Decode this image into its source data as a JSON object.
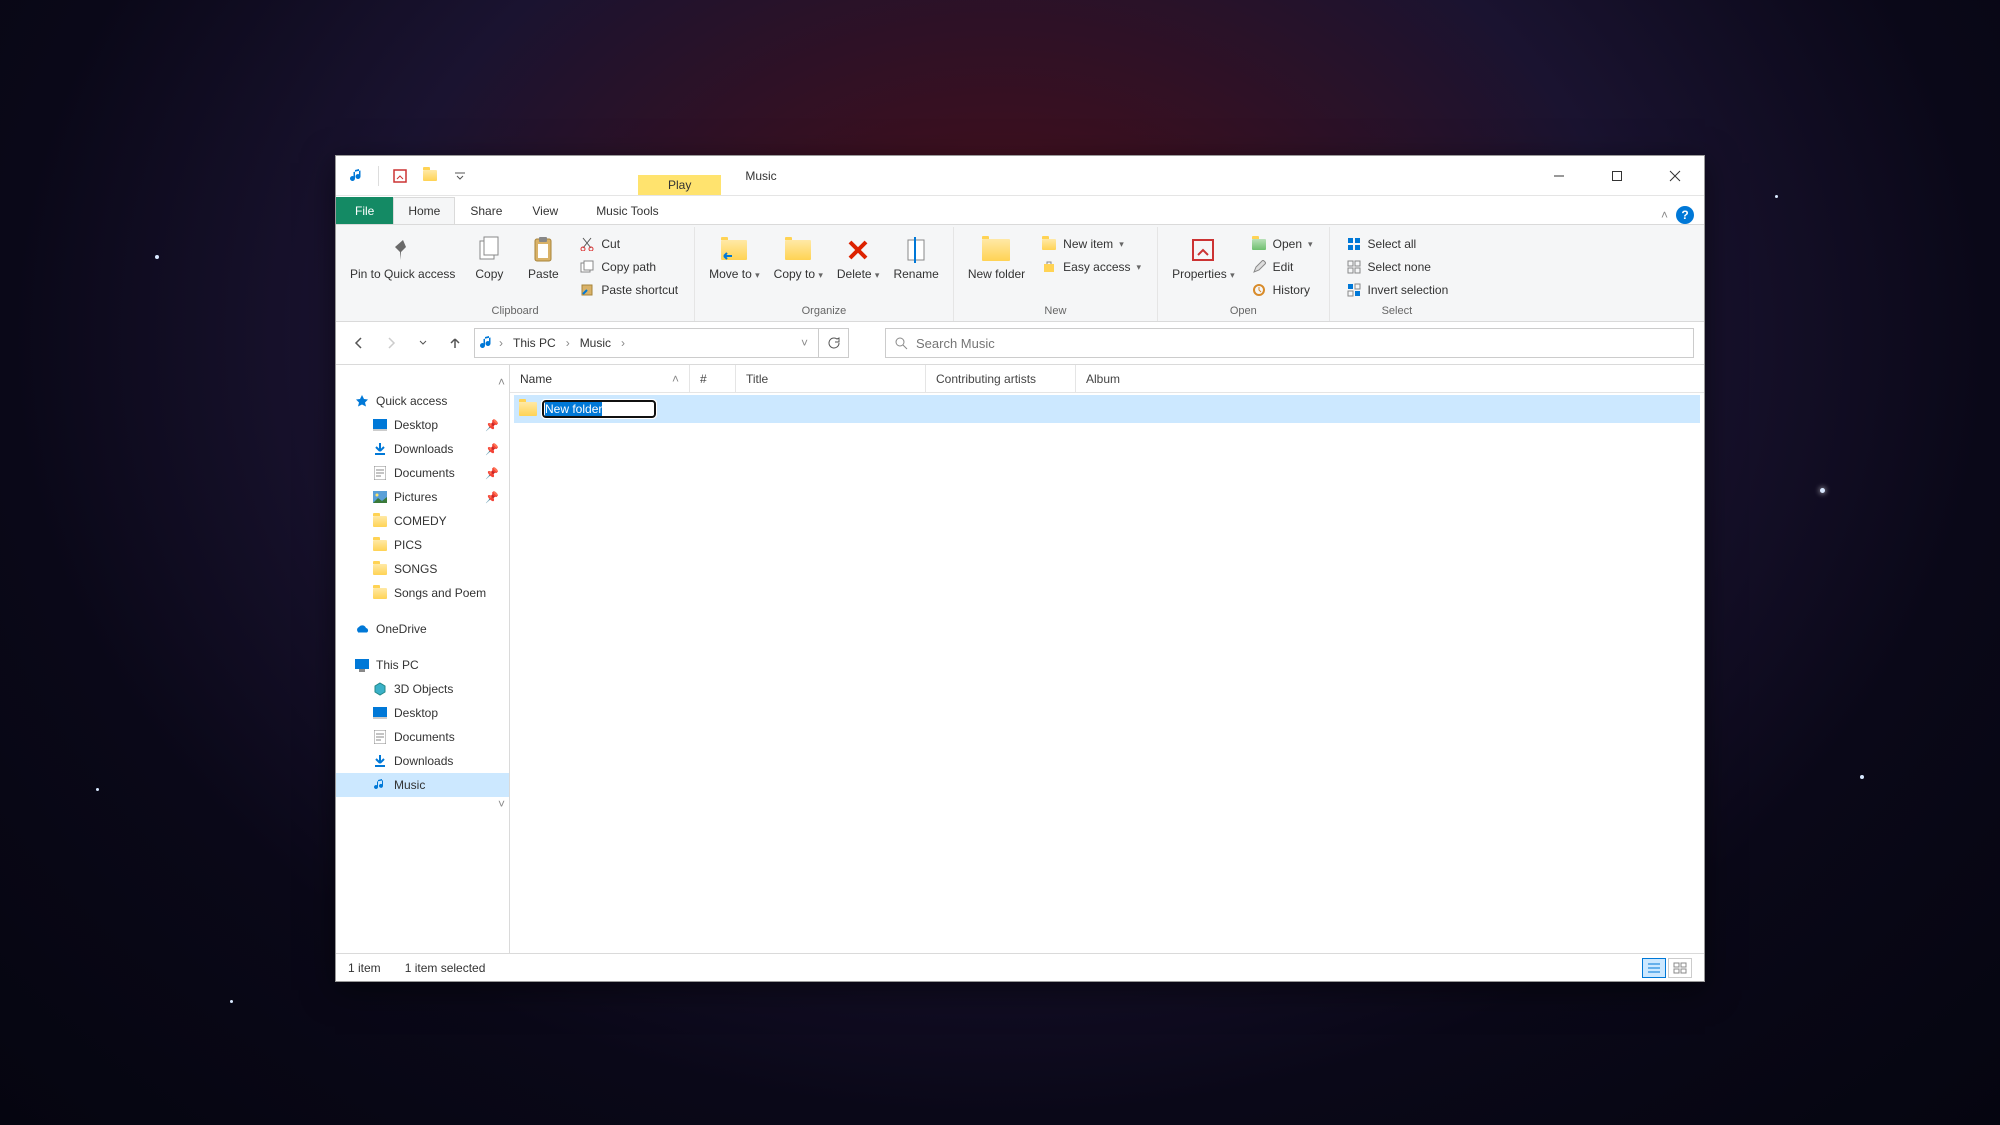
{
  "title": "Music",
  "contextTab": {
    "header": "Play",
    "label": "Music Tools"
  },
  "tabs": {
    "file": "File",
    "home": "Home",
    "share": "Share",
    "view": "View"
  },
  "ribbon": {
    "clipboard": {
      "label": "Clipboard",
      "pin": "Pin to Quick access",
      "copy": "Copy",
      "paste": "Paste",
      "cut": "Cut",
      "copyPath": "Copy path",
      "pasteShortcut": "Paste shortcut"
    },
    "organize": {
      "label": "Organize",
      "moveTo": "Move to",
      "copyTo": "Copy to",
      "delete": "Delete",
      "rename": "Rename"
    },
    "new": {
      "label": "New",
      "newFolder": "New folder",
      "newItem": "New item",
      "easyAccess": "Easy access"
    },
    "open": {
      "label": "Open",
      "properties": "Properties",
      "open": "Open",
      "edit": "Edit",
      "history": "History"
    },
    "select": {
      "label": "Select",
      "selectAll": "Select all",
      "selectNone": "Select none",
      "invert": "Invert selection"
    }
  },
  "breadcrumb": {
    "pc": "This PC",
    "folder": "Music"
  },
  "search": {
    "placeholder": "Search Music"
  },
  "sidebar": {
    "quickAccess": "Quick access",
    "qa": {
      "desktop": "Desktop",
      "downloads": "Downloads",
      "documents": "Documents",
      "pictures": "Pictures",
      "comedy": "COMEDY",
      "pics": "PICS",
      "songs": "SONGS",
      "poems": "Songs and Poem"
    },
    "onedrive": "OneDrive",
    "thisPC": "This PC",
    "pc": {
      "objects3d": "3D Objects",
      "desktop": "Desktop",
      "documents": "Documents",
      "downloads": "Downloads",
      "music": "Music"
    }
  },
  "columns": {
    "name": "Name",
    "num": "#",
    "title": "Title",
    "artists": "Contributing artists",
    "album": "Album"
  },
  "file": {
    "rename": "New folder"
  },
  "status": {
    "count": "1 item",
    "selected": "1 item selected"
  }
}
